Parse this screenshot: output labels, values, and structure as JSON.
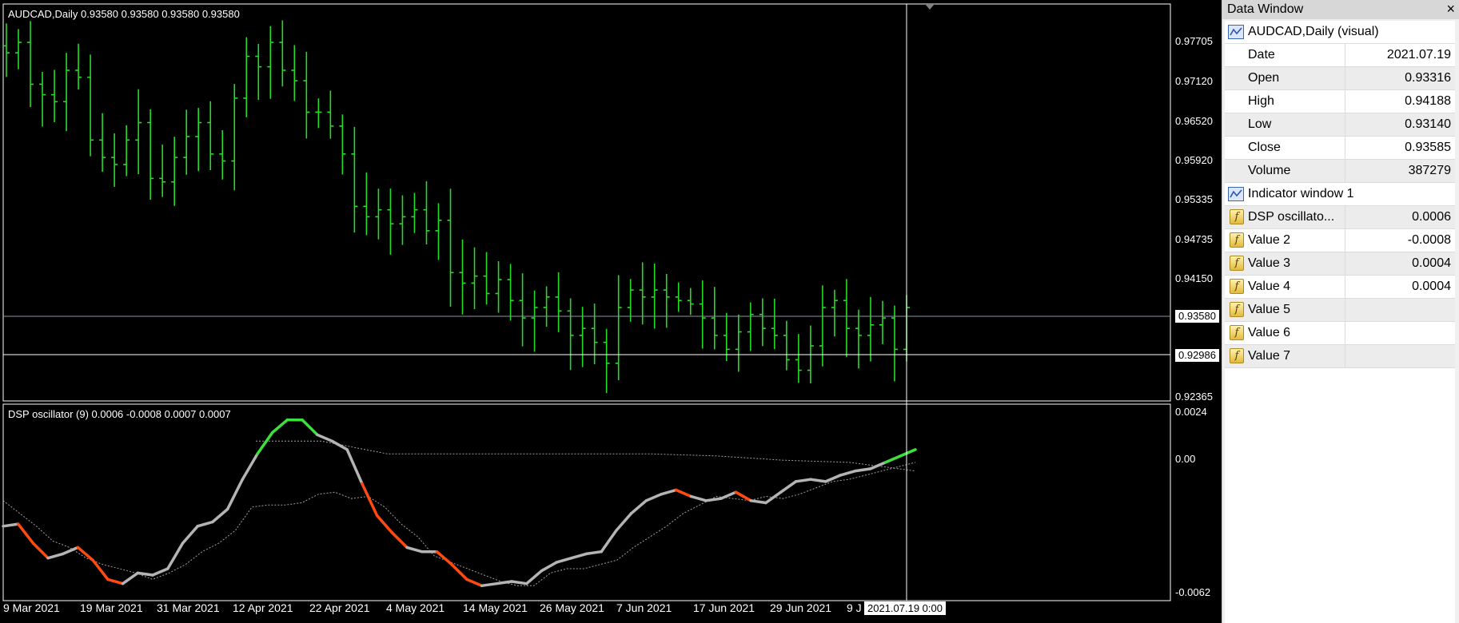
{
  "chart": {
    "symbol_label": "AUDCAD,Daily  0.93580 0.93580 0.93580 0.93580",
    "indicator_label": "DSP oscillator (9) 0.0006 -0.0008 0.0007 0.0007",
    "price_axis": [
      "0.97705",
      "0.97120",
      "0.96520",
      "0.95920",
      "0.95335",
      "0.94735",
      "0.94150",
      "0.92365"
    ],
    "price_tags": [
      "0.93580",
      "0.92986"
    ],
    "indicator_axis": [
      "0.0024",
      "0.00",
      "-0.0062"
    ],
    "date_axis": [
      "9 Mar 2021",
      "19 Mar 2021",
      "31 Mar 2021",
      "12 Apr 2021",
      "22 Apr 2021",
      "4 May 2021",
      "14 May 2021",
      "26 May 2021",
      "7 Jun 2021",
      "17 Jun 2021",
      "29 Jun 2021",
      "9 J"
    ],
    "crosshair_date": "2021.07.19 0:00",
    "colors": {
      "background": "#000000",
      "bars": "#22dd22",
      "osc_neutral": "#b4b4b4",
      "osc_down": "#ff4a10",
      "osc_up": "#3ee03e"
    }
  },
  "chart_data": [
    {
      "type": "ohlc",
      "title": "AUDCAD,Daily",
      "ylim": [
        0.9226,
        0.9795
      ],
      "x_range": [
        "2021-03-08",
        "2021-07-19"
      ],
      "closes_approx": [
        0.9725,
        0.974,
        0.968,
        0.9665,
        0.9655,
        0.97,
        0.969,
        0.96,
        0.9575,
        0.9565,
        0.96,
        0.9625,
        0.9545,
        0.954,
        0.9575,
        0.9605,
        0.9625,
        0.958,
        0.957,
        0.966,
        0.972,
        0.9705,
        0.974,
        0.97,
        0.9685,
        0.964,
        0.964,
        0.962,
        0.958,
        0.9505,
        0.949,
        0.95,
        0.948,
        0.949,
        0.95,
        0.947,
        0.9485,
        0.941,
        0.9395,
        0.9405,
        0.938,
        0.94,
        0.937,
        0.9345,
        0.936,
        0.9375,
        0.9355,
        0.932,
        0.933,
        0.931,
        0.928,
        0.936,
        0.9385,
        0.9375,
        0.9385,
        0.9375,
        0.937,
        0.9365,
        0.9345,
        0.932,
        0.93,
        0.9325,
        0.935,
        0.933,
        0.932,
        0.9285,
        0.927,
        0.9305,
        0.936,
        0.937,
        0.933,
        0.932,
        0.9335,
        0.9345,
        0.93,
        0.936
      ]
    },
    {
      "type": "line",
      "title": "DSP oscillator (9)",
      "ylim": [
        -0.0062,
        0.0024
      ],
      "series": [
        {
          "values": [
            -0.003,
            -0.0029,
            -0.0038,
            -0.0045,
            -0.0043,
            -0.004,
            -0.0046,
            -0.0055,
            -0.0057,
            -0.0052,
            -0.0053,
            -0.005,
            -0.0038,
            -0.003,
            -0.0028,
            -0.0022,
            -0.0008,
            0.0004,
            0.0014,
            0.002,
            0.002,
            0.0013,
            0.001,
            0.0006,
            -0.001,
            -0.0025,
            -0.0033,
            -0.004,
            -0.0042,
            -0.0042,
            -0.0048,
            -0.0055,
            -0.0058,
            -0.0057,
            -0.0056,
            -0.0057,
            -0.0051,
            -0.0047,
            -0.0045,
            -0.0043,
            -0.0042,
            -0.0032,
            -0.0024,
            -0.0018,
            -0.0015,
            -0.0013,
            -0.0016,
            -0.0018,
            -0.0017,
            -0.0014,
            -0.0018,
            -0.0019,
            -0.0014,
            -0.0009,
            -0.0008,
            -0.0009,
            -0.0006,
            -0.0004,
            -0.0003,
            0.0,
            0.0003,
            0.0006
          ]
        },
        {
          "values": [
            -0.0018,
            -0.0024,
            -0.003,
            -0.0037,
            -0.004,
            -0.0045,
            -0.0048,
            -0.005,
            -0.0052,
            -0.0055,
            -0.0052,
            -0.0048,
            -0.0042,
            -0.0038,
            -0.0032,
            -0.0021,
            -0.002,
            -0.002,
            -0.0019,
            -0.0015,
            -0.0014,
            -0.0017,
            -0.0016,
            -0.0021,
            -0.0029,
            -0.0035,
            -0.0044,
            -0.0047,
            -0.005,
            -0.0053,
            -0.0056,
            -0.0058,
            -0.0058,
            -0.0052,
            -0.005,
            -0.005,
            -0.0048,
            -0.0046,
            -0.004,
            -0.0035,
            -0.003,
            -0.0024,
            -0.002,
            -0.0016,
            -0.0017,
            -0.0018,
            -0.0016,
            -0.0017,
            -0.0015,
            -0.0012,
            -0.0009,
            -0.0008,
            -0.0006,
            -0.0004,
            -0.0002,
            0.0
          ]
        },
        {
          "values": [
            0.001,
            0.001,
            0.0004,
            0.0004,
            0.0004,
            0.0004,
            0.0004,
            0.0003,
            0.0001,
            0.0,
            -0.0004
          ]
        }
      ]
    }
  ],
  "data_window": {
    "title": "Data Window",
    "close_symbol": "×",
    "group1": "AUDCAD,Daily (visual)",
    "rows1": [
      {
        "label": "Date",
        "value": "2021.07.19"
      },
      {
        "label": "Open",
        "value": "0.93316"
      },
      {
        "label": "High",
        "value": "0.94188"
      },
      {
        "label": "Low",
        "value": "0.93140"
      },
      {
        "label": "Close",
        "value": "0.93585"
      },
      {
        "label": "Volume",
        "value": "387279"
      }
    ],
    "group2": "Indicator window 1",
    "rows2": [
      {
        "label": "DSP oscillato...",
        "value": "0.0006"
      },
      {
        "label": "Value 2",
        "value": "-0.0008"
      },
      {
        "label": "Value 3",
        "value": "0.0004"
      },
      {
        "label": "Value 4",
        "value": "0.0004"
      },
      {
        "label": "Value 5",
        "value": ""
      },
      {
        "label": "Value 6",
        "value": ""
      },
      {
        "label": "Value 7",
        "value": ""
      }
    ]
  }
}
